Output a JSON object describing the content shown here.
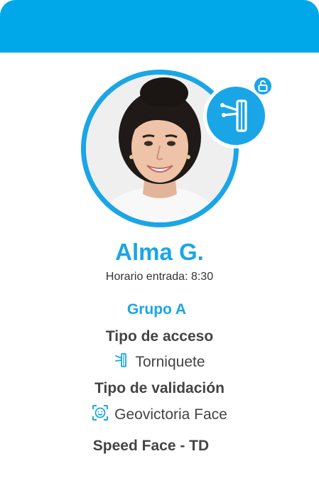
{
  "profile": {
    "name": "Alma G.",
    "schedule": "Horario entrada: 8:30",
    "group": "Grupo A"
  },
  "access": {
    "type_label": "Tipo de acceso",
    "type_value": "Torniquete",
    "type_icon": "turnstile-icon",
    "validation_label": "Tipo de validación",
    "validation_value": "Geovictoria Face",
    "validation_icon": "face-scan-icon"
  },
  "device": {
    "name": "Speed Face - TD"
  },
  "colors": {
    "accent": "#1aa6e6",
    "header": "#00a8ea",
    "text": "#444444"
  }
}
